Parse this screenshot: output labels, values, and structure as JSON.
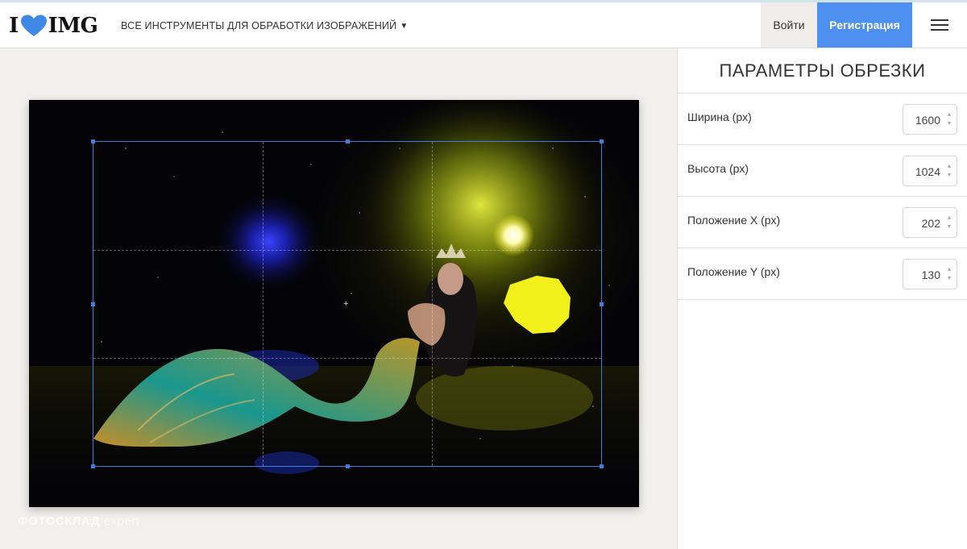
{
  "header": {
    "logo": {
      "left": "I",
      "right": "IMG",
      "heart_color": "#3e89e6"
    },
    "tools_menu_label": "ВСЕ ИНСТРУМЕНТЫ ДЛЯ ОБРАБОТКИ ИЗОБРАЖЕНИЙ",
    "login_label": "Войти",
    "register_label": "Регистрация",
    "register_color": "#4d90f0",
    "menu_icon": "hamburger-menu-icon"
  },
  "watermark": {
    "bold": "ФОТОСКЛАД",
    "light": "expert"
  },
  "panel": {
    "title": "ПАРАМЕТРЫ ОБРЕЗКИ",
    "params": [
      {
        "label": "Ширина (px)",
        "value": "1600"
      },
      {
        "label": "Высота (px)",
        "value": "1024"
      },
      {
        "label": "Положение X (px)",
        "value": "202"
      },
      {
        "label": "Положение Y (px)",
        "value": "130"
      }
    ]
  }
}
